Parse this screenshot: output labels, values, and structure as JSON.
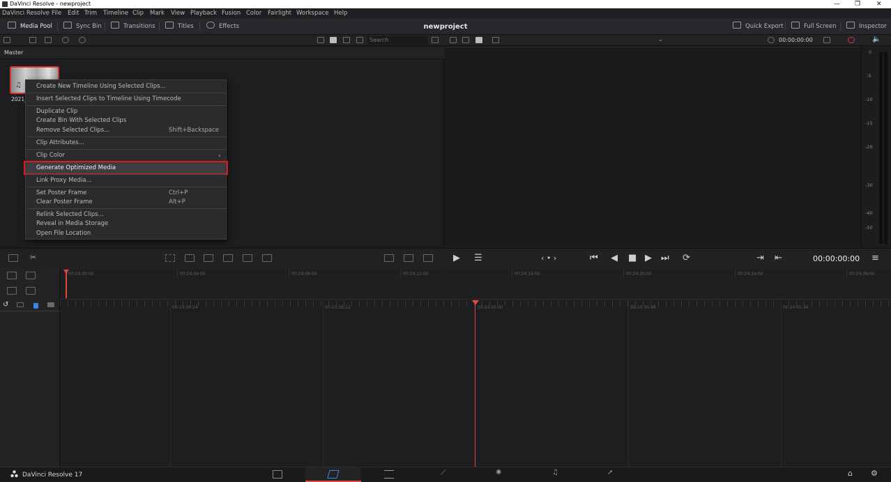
{
  "window": {
    "title": "DaVinci Resolve - newproject",
    "controls": {
      "minimize": "—",
      "restore": "❐",
      "close": "✕"
    }
  },
  "menubar": [
    "DaVinci Resolve",
    "File",
    "Edit",
    "Trim",
    "Timeline",
    "Clip",
    "Mark",
    "View",
    "Playback",
    "Fusion",
    "Color",
    "Fairlight",
    "Workspace",
    "Help"
  ],
  "toolbar": {
    "media_pool": "Media Pool",
    "sync_bin": "Sync Bin",
    "transitions": "Transitions",
    "titles": "Titles",
    "effects": "Effects",
    "project_name": "newproject",
    "quick_export": "Quick Export",
    "full_screen": "Full Screen",
    "inspector": "Inspector"
  },
  "subtoolbar": {
    "search_placeholder": "Search",
    "timecode": "00:00:00:00"
  },
  "media_pool": {
    "bin_name": "Master",
    "clip_name": "2021_"
  },
  "context_menu": {
    "items": [
      {
        "label": "Create New Timeline Using Selected Clips...",
        "shortcut": ""
      },
      {
        "label": "Insert Selected Clips to Timeline Using Timecode",
        "shortcut": ""
      },
      {
        "label": "Duplicate Clip",
        "shortcut": ""
      },
      {
        "label": "Create Bin With Selected Clips",
        "shortcut": ""
      },
      {
        "label": "Remove Selected Clips...",
        "shortcut": "Shift+Backspace"
      },
      {
        "label": "Clip Attributes...",
        "shortcut": ""
      },
      {
        "label": "Clip Color",
        "shortcut": ""
      },
      {
        "label": "Generate Optimized Media",
        "shortcut": ""
      },
      {
        "label": "Link Proxy Media...",
        "shortcut": ""
      },
      {
        "label": "Set Poster Frame",
        "shortcut": "Ctrl+P"
      },
      {
        "label": "Clear Poster Frame",
        "shortcut": "Alt+P"
      },
      {
        "label": "Relink Selected Clips...",
        "shortcut": ""
      },
      {
        "label": "Reveal in Media Storage",
        "shortcut": ""
      },
      {
        "label": "Open File Location",
        "shortcut": ""
      }
    ],
    "highlighted": "Generate Optimized Media",
    "submenu_arrow": "›"
  },
  "audio_meter": {
    "labels": [
      "0",
      "-5",
      "-10",
      "-15",
      "-20",
      "-30",
      "-40",
      "-50"
    ]
  },
  "transport": {
    "timecode": "00:00:00:00"
  },
  "timeline": {
    "upper_ticks": [
      "00:24:00:00",
      "00:24:04:00",
      "00:24:08:00",
      "00:24:12:00",
      "00:24:16:00",
      "00:24:20:00",
      "00:24:24:00",
      "00:24:28:00"
    ],
    "lower_ticks": [
      "00:23:59:24",
      "00:23:59:12",
      "00:24:00:00",
      "00:24:00:48",
      "00:24:01:36"
    ]
  },
  "pagebar": {
    "brand": "DaVinci Resolve 17",
    "pages": [
      "media-page-icon",
      "cut-page-icon",
      "edit-page-icon",
      "fusion-page-icon",
      "color-page-icon",
      "fairlight-page-icon",
      "deliver-page-icon"
    ]
  },
  "colors": {
    "accent_red": "#e5493d",
    "highlight_box": "#e11b1b"
  }
}
